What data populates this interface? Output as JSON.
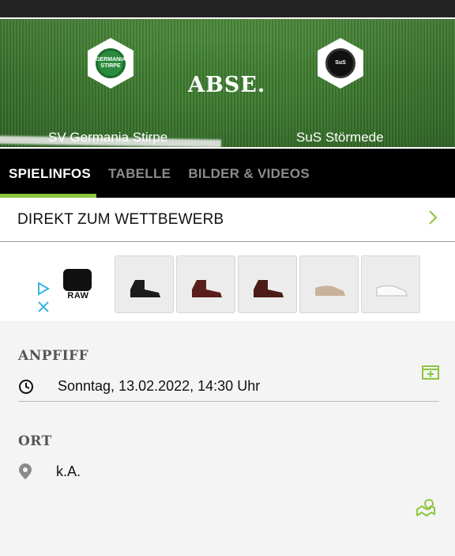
{
  "header": {
    "brand": "ABSE.",
    "home_team": "SV Germania Stirpe",
    "away_team": "SuS Störmede",
    "home_crest_text": "GERMANIA STIRPE",
    "away_crest_text": "SuS"
  },
  "tabs": [
    {
      "label": "SPIELINFOS",
      "active": true
    },
    {
      "label": "TABELLE",
      "active": false
    },
    {
      "label": "BILDER & VIDEOS",
      "active": false
    }
  ],
  "competition_link": {
    "label": "DIREKT ZUM WETTBEWERB",
    "icon": "chevron-right-icon"
  },
  "ad": {
    "brand_text": "RAW",
    "products": [
      "black-chelsea-boot",
      "brown-chelsea-boot",
      "brown-chelsea-boot",
      "beige-sneaker",
      "white-sneaker"
    ]
  },
  "kickoff": {
    "title": "ANPFIFF",
    "value": "Sonntag, 13.02.2022, 14:30 Uhr"
  },
  "location": {
    "title": "ORT",
    "value": "k.A."
  },
  "colors": {
    "accent": "#8cc63f",
    "tabbar": "#000000",
    "topbar": "#232323"
  }
}
